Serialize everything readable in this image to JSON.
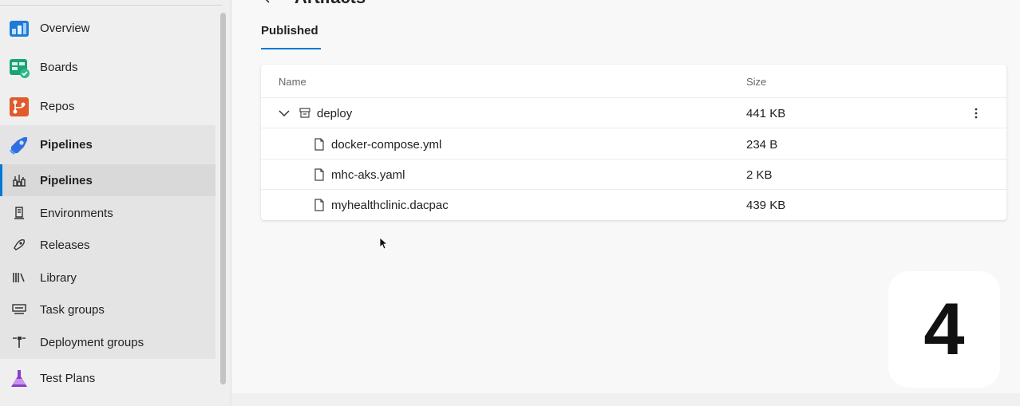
{
  "sidebar": {
    "top_items": [
      {
        "label": "Overview",
        "icon": "overview-icon"
      },
      {
        "label": "Boards",
        "icon": "boards-icon"
      },
      {
        "label": "Repos",
        "icon": "repos-icon"
      },
      {
        "label": "Pipelines",
        "icon": "pipelines-icon"
      }
    ],
    "sub_items": [
      {
        "label": "Pipelines",
        "icon": "pipelines-sub-icon"
      },
      {
        "label": "Environments",
        "icon": "environments-icon"
      },
      {
        "label": "Releases",
        "icon": "releases-icon"
      },
      {
        "label": "Library",
        "icon": "library-icon"
      },
      {
        "label": "Task groups",
        "icon": "task-groups-icon"
      },
      {
        "label": "Deployment groups",
        "icon": "deployment-groups-icon"
      }
    ],
    "bottom_items": [
      {
        "label": "Test Plans",
        "icon": "test-plans-icon"
      }
    ]
  },
  "main": {
    "title": "Artifacts",
    "tab": "Published",
    "columns": {
      "name": "Name",
      "size": "Size"
    },
    "folder": {
      "name": "deploy",
      "size": "441 KB"
    },
    "files": [
      {
        "name": "docker-compose.yml",
        "size": "234 B"
      },
      {
        "name": "mhc-aks.yaml",
        "size": "2 KB"
      },
      {
        "name": "myhealthclinic.dacpac",
        "size": "439 KB"
      }
    ]
  },
  "overlay": {
    "step_number": "4"
  },
  "colors": {
    "accent": "#0078d4",
    "sidebar_bg": "#efefef",
    "group_bg": "#e4e4e4"
  }
}
